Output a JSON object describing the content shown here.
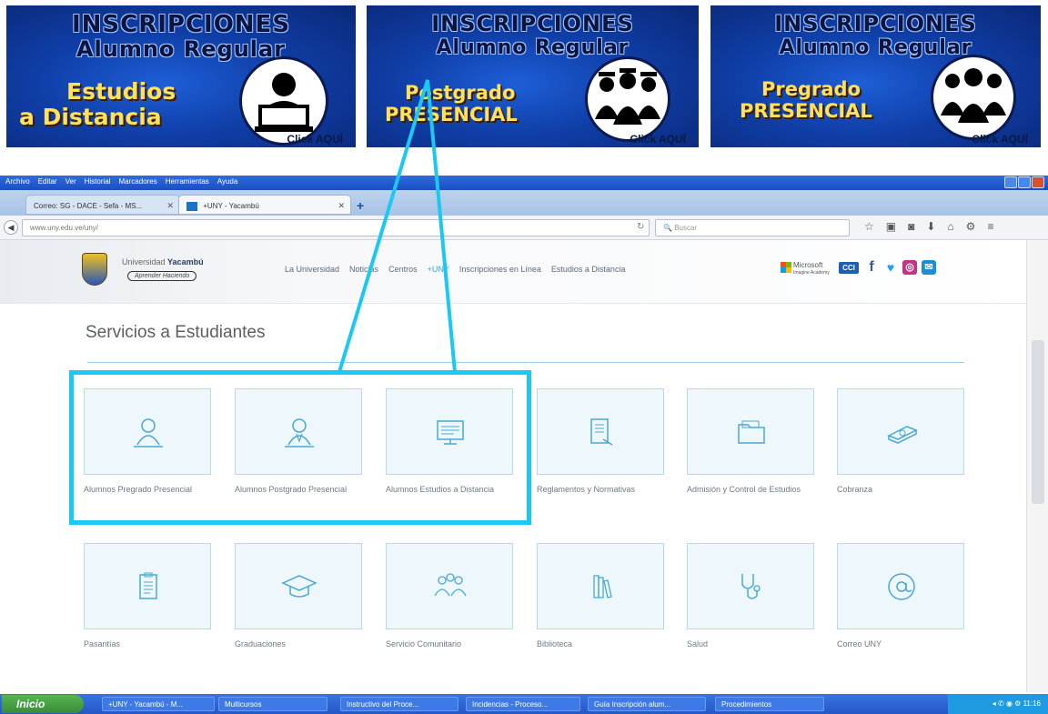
{
  "banners": [
    {
      "title1": "INSCRIPCIONES",
      "title2": "Alumno Regular",
      "sub1": "Estudios",
      "sub2": "a Distancia",
      "click": "Click AQUÍ",
      "icon": "student-laptop-icon"
    },
    {
      "title1": "INSCRIPCIONES",
      "title2": "Alumno Regular",
      "sub1": "Postgrado",
      "sub2": "PRESENCIAL",
      "click": "Click AQUÍ",
      "icon": "graduates-group-icon"
    },
    {
      "title1": "INSCRIPCIONES",
      "title2": "Alumno Regular",
      "sub1": "Pregrado",
      "sub2": "PRESENCIAL",
      "click": "Click AQUÍ",
      "icon": "students-group-icon"
    }
  ],
  "browser": {
    "menu": [
      "Archivo",
      "Editar",
      "Ver",
      "Historial",
      "Marcadores",
      "Herramientas",
      "Ayuda"
    ],
    "tabs": [
      "Correo: SG - DACE - Sefa - MS...",
      "+UNY - Yacambú"
    ],
    "url": "www.uny.edu.ve/uny/",
    "search_placeholder": "Buscar"
  },
  "site": {
    "logo_name": "Universidad",
    "logo_name_bold": "Yacambú",
    "slogan": "Aprender Haciendo",
    "nav": [
      "La Universidad",
      "Noticias",
      "Centros",
      "+UNY",
      "Inscripciones en Línea",
      "Estudios a Distancia"
    ],
    "ms_text": "Microsoft",
    "ms_sub": "Imagine Academy",
    "cci": "CCI",
    "section_title": "Servicios a Estudiantes",
    "services": [
      {
        "label": "Alumnos Pregrado Presencial",
        "icon": "student-icon"
      },
      {
        "label": "Alumnos Postgrado Presencial",
        "icon": "graduate-icon"
      },
      {
        "label": "Alumnos Estudios a Distancia",
        "icon": "monitor-icon"
      },
      {
        "label": "Reglamentos y Normativas",
        "icon": "document-icon"
      },
      {
        "label": "Admisión y Control de Estudios",
        "icon": "folder-icon"
      },
      {
        "label": "Cobranza",
        "icon": "money-icon"
      },
      {
        "label": "Pasantías",
        "icon": "clipboard-icon"
      },
      {
        "label": "Graduaciones",
        "icon": "mortarboard-icon"
      },
      {
        "label": "Servicio Comunitario",
        "icon": "community-icon"
      },
      {
        "label": "Biblioteca",
        "icon": "books-icon"
      },
      {
        "label": "Salud",
        "icon": "stethoscope-icon"
      },
      {
        "label": "Correo UNY",
        "icon": "at-sign-icon"
      }
    ]
  },
  "taskbar": {
    "start": "Inicio",
    "tasks": [
      "+UNY - Yacambú - M...",
      "Multicursos",
      "Instructivo del Proce...",
      "Incidencias - Proceso...",
      "Guía Inscripción alum...",
      "Procedimientos"
    ],
    "clock": "11:16"
  },
  "colors": {
    "highlight": "#1bc8f4",
    "tile_border": "#b9dbe9",
    "accent": "#3aa5d8"
  }
}
